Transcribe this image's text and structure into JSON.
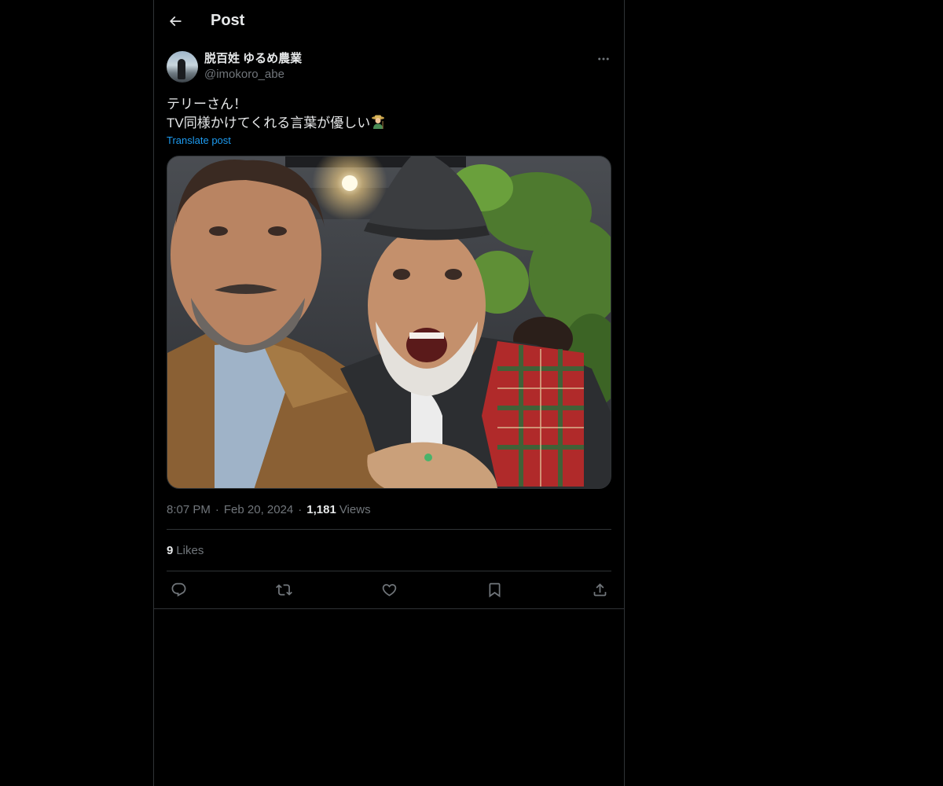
{
  "header": {
    "title": "Post"
  },
  "post": {
    "author": {
      "display_name": "脱百姓 ゆるめ農業",
      "handle": "@imokoro_abe"
    },
    "text_line1": "テリーさん！",
    "text_line2": "TV同様かけてくれる言葉が優しい",
    "translate_label": "Translate post",
    "time": "8:07 PM",
    "date": "Feb 20, 2024",
    "views_count": "1,181",
    "views_label": "Views",
    "likes_count": "9",
    "likes_label": "Likes"
  },
  "icons": {
    "back": "back-arrow-icon",
    "more": "more-icon",
    "reply": "reply-icon",
    "repost": "repost-icon",
    "like": "heart-icon",
    "bookmark": "bookmark-icon",
    "share": "share-icon",
    "emoji": "farmer-emoji"
  },
  "colors": {
    "background": "#000000",
    "text": "#e7e9ea",
    "secondary": "#71767b",
    "link": "#1d9bf0",
    "border": "#2f3336"
  }
}
